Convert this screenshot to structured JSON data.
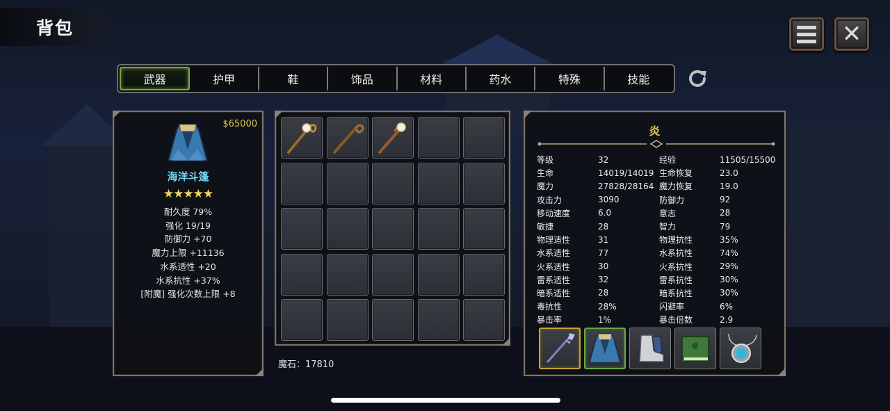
{
  "title": "背包",
  "header_buttons": {
    "menu_icon": "menu-icon",
    "close_icon": "close-icon"
  },
  "tabs": [
    {
      "label": "武器",
      "active": true
    },
    {
      "label": "护甲",
      "active": false
    },
    {
      "label": "鞋",
      "active": false
    },
    {
      "label": "饰品",
      "active": false
    },
    {
      "label": "材料",
      "active": false
    },
    {
      "label": "药水",
      "active": false
    },
    {
      "label": "特殊",
      "active": false
    },
    {
      "label": "技能",
      "active": false
    }
  ],
  "refresh_icon": "refresh-icon",
  "item_detail": {
    "price": "$65000",
    "name": "海洋斗篷",
    "stars": "★★★★★",
    "star_count": 5,
    "attributes": [
      "耐久度 79%",
      "强化 19/19",
      "防御力 +70",
      "魔力上限 +11136",
      "水系适性 +20",
      "水系抗性 +37%",
      "[附魔] 强化次数上限 +8"
    ]
  },
  "inventory": {
    "slots": [
      {
        "item": "golden-crook-staff-icon"
      },
      {
        "item": "curled-wooden-staff-icon"
      },
      {
        "item": "orb-staff-icon"
      },
      {
        "item": null
      },
      {
        "item": null
      },
      {
        "item": null
      },
      {
        "item": null
      },
      {
        "item": null
      },
      {
        "item": null
      },
      {
        "item": null
      },
      {
        "item": null
      },
      {
        "item": null
      },
      {
        "item": null
      },
      {
        "item": null
      },
      {
        "item": null
      },
      {
        "item": null
      },
      {
        "item": null
      },
      {
        "item": null
      },
      {
        "item": null
      },
      {
        "item": null
      },
      {
        "item": null
      },
      {
        "item": null
      },
      {
        "item": null
      },
      {
        "item": null
      },
      {
        "item": null
      }
    ],
    "magic_stone": "魔石：17810"
  },
  "character": {
    "name": "炎",
    "stats": [
      [
        "等级",
        "32",
        "经验",
        "11505/15500"
      ],
      [
        "生命",
        "14019/14019",
        "生命恢复",
        "23.0"
      ],
      [
        "魔力",
        "27828/28164",
        "魔力恢复",
        "19.0"
      ],
      [
        "攻击力",
        "3090",
        "防御力",
        "92"
      ],
      [
        "移动速度",
        "6.0",
        "意志",
        "28"
      ],
      [
        "敏捷",
        "28",
        "智力",
        "79"
      ],
      [
        "物理适性",
        "31",
        "物理抗性",
        "35%"
      ],
      [
        "水系适性",
        "77",
        "水系抗性",
        "74%"
      ],
      [
        "火系适性",
        "30",
        "火系抗性",
        "29%"
      ],
      [
        "雷系适性",
        "32",
        "雷系抗性",
        "30%"
      ],
      [
        "暗系适性",
        "28",
        "暗系抗性",
        "30%"
      ],
      [
        "毒抗性",
        "28%",
        "闪避率",
        "6%"
      ],
      [
        "暴击率",
        "1%",
        "暴击倍数",
        "2.9"
      ]
    ],
    "equipment": [
      {
        "icon": "spear-icon",
        "highlight": "gold"
      },
      {
        "icon": "cloak-icon",
        "highlight": "green"
      },
      {
        "icon": "boots-icon",
        "highlight": "none"
      },
      {
        "icon": "spellbook-icon",
        "highlight": "none"
      },
      {
        "icon": "amulet-icon",
        "highlight": "none"
      }
    ]
  },
  "colors": {
    "accent_gold": "#e6c85a",
    "item_name": "#6fd9ef",
    "active_tab": "#6fa84a"
  }
}
